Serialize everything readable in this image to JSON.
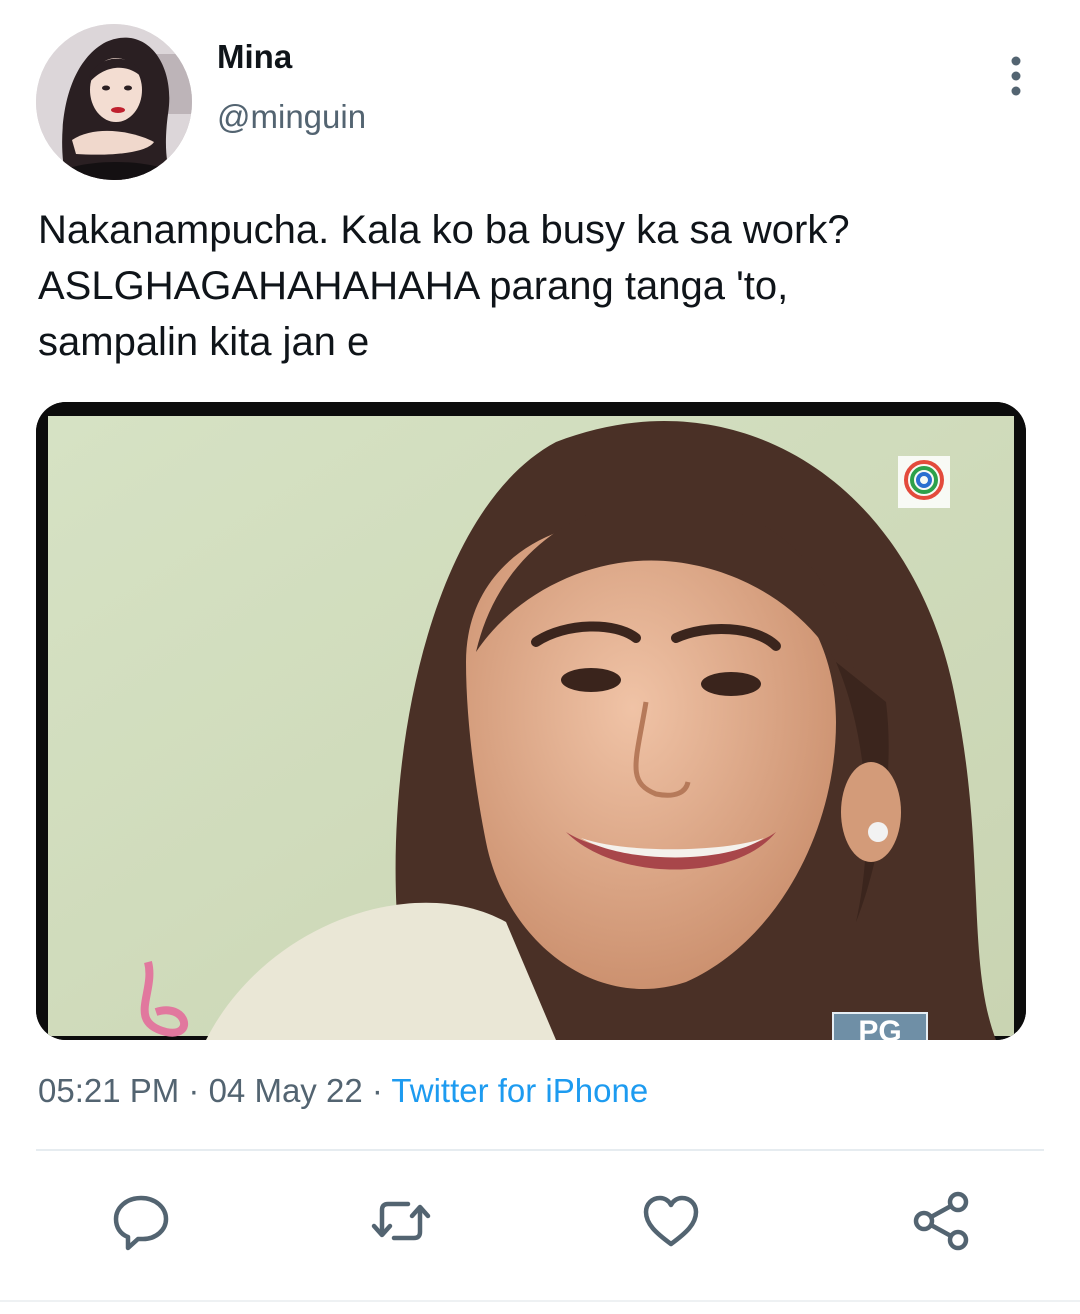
{
  "user": {
    "display_name": "Mina",
    "handle": "@minguin"
  },
  "tweet": {
    "lines": [
      "Nakanampucha. Kala ko ba busy ka sa work?",
      "ASLGHAGAHAHAHAHA parang tanga 'to,",
      "sampalin kita jan e"
    ],
    "media": {
      "overlay_badge": "PG"
    },
    "meta": {
      "time": "05:21 PM",
      "date": "04 May 22",
      "separator": " · ",
      "source": "Twitter for iPhone"
    }
  },
  "actions": {
    "icons": [
      "reply-icon",
      "retweet-icon",
      "like-icon",
      "share-icon"
    ]
  },
  "colors": {
    "text_primary": "#0f1419",
    "text_secondary": "#536471",
    "accent": "#1d9bf0",
    "divider": "#e6ecf0"
  }
}
